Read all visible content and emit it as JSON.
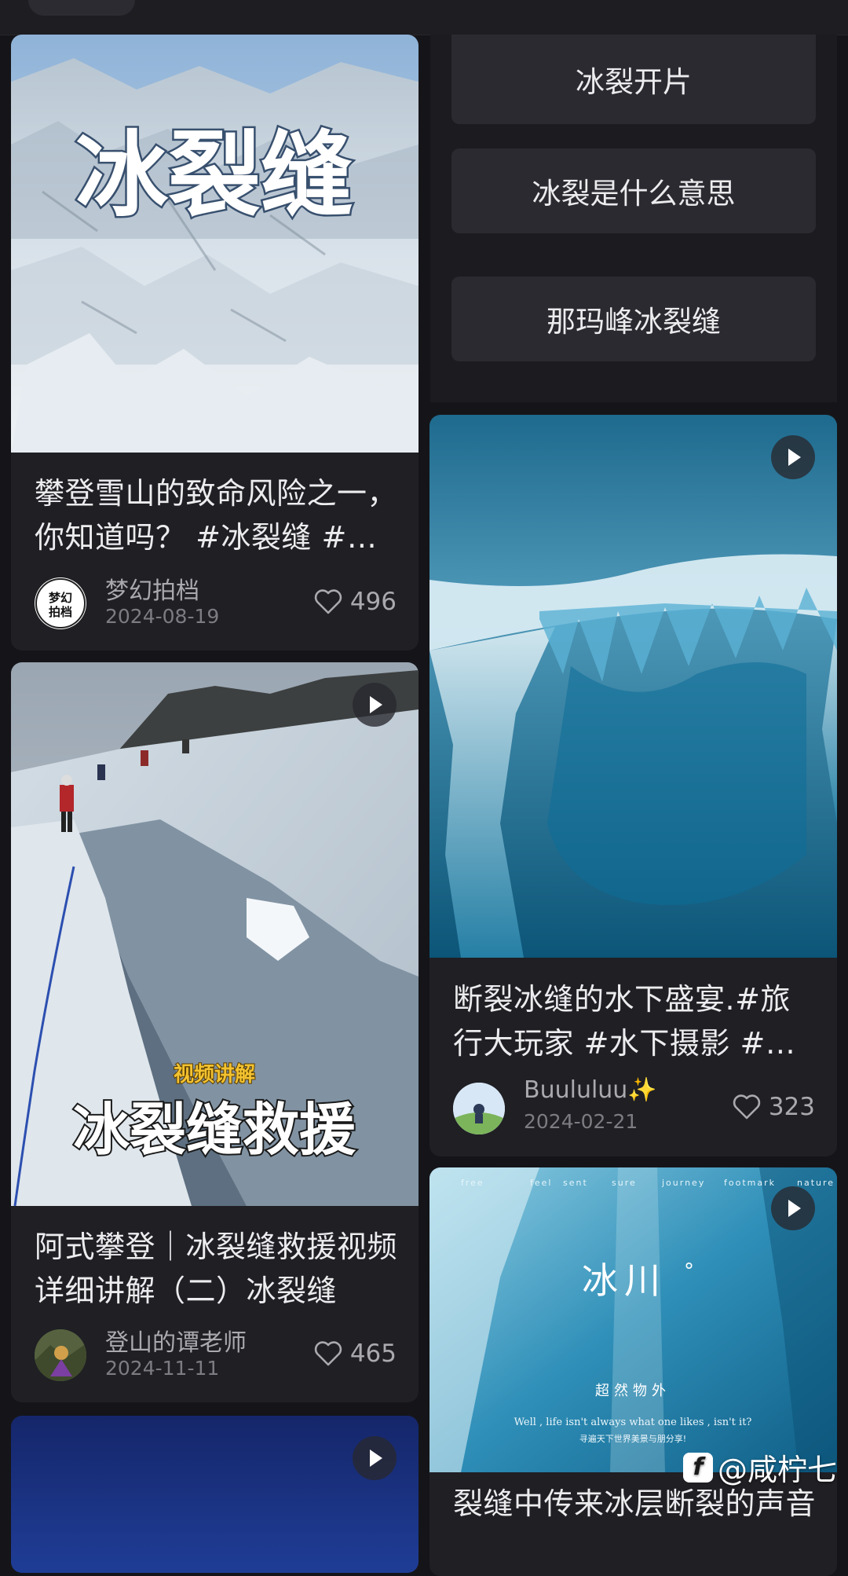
{
  "related_searches": [
    "冰裂开片",
    "冰裂是什么意思",
    "那玛峰冰裂缝"
  ],
  "cards": [
    {
      "title": "攀登雪山的致命风险之一，你知道吗？ #冰裂缝 #雪山",
      "thumb_text": "冰裂缝",
      "author": "梦幻拍档",
      "avatar_text": "梦幻拍档",
      "date": "2024-08-19",
      "likes": "496"
    },
    {
      "title": "阿式攀登｜冰裂缝救援视频详细讲解（二）冰裂缝",
      "thumb_subtitle": "视频讲解",
      "thumb_text": "冰裂缝救援",
      "author": "登山的谭老师",
      "date": "2024-11-11",
      "likes": "465"
    },
    {
      "title": "断裂冰缝的水下盛宴.#旅行大玩家 #水下摄影 #冰川",
      "author": "Buululuu✨",
      "date": "2024-02-21",
      "likes": "323"
    },
    {
      "title": "裂缝中传来冰层断裂的声音",
      "thumb_words": [
        "free",
        "feel",
        "sent",
        "sure",
        "journey",
        "footmark",
        "nature"
      ],
      "thumb_title": "冰川",
      "thumb_degree": "°",
      "thumb_sub": "超然物外",
      "thumb_quote": "Well , life isn't always what one likes , isn't it?",
      "thumb_sub2": "寻遍天下世界美景与朋分享!"
    }
  ],
  "watermark": {
    "logo": "f",
    "text": "@咸柠七"
  },
  "icons": {
    "play": "play-icon",
    "like": "heart-icon"
  }
}
